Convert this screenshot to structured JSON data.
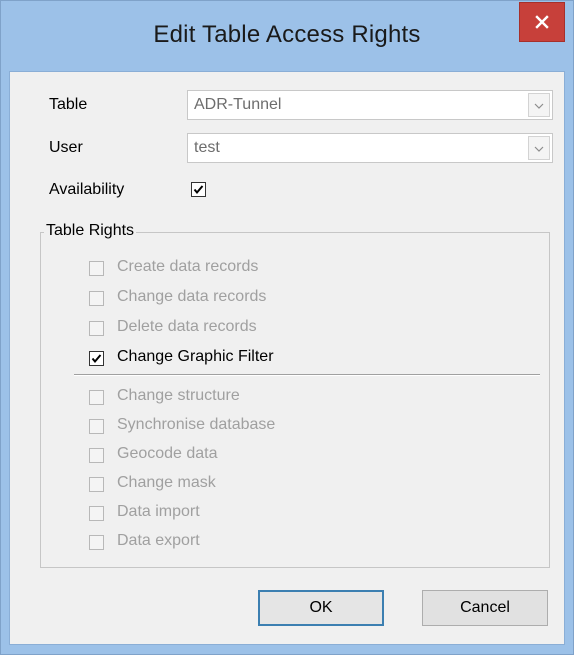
{
  "window": {
    "title": "Edit Table Access Rights",
    "close_icon": "close-icon"
  },
  "form": {
    "table_label": "Table",
    "table_value": "ADR-Tunnel",
    "user_label": "User",
    "user_value": "test",
    "availability_label": "Availability",
    "availability_checked": true
  },
  "table_rights": {
    "legend": "Table Rights",
    "group1": [
      {
        "label": "Create data records",
        "checked": false,
        "enabled": false
      },
      {
        "label": "Change data records",
        "checked": false,
        "enabled": false
      },
      {
        "label": "Delete data records",
        "checked": false,
        "enabled": false
      },
      {
        "label": "Change Graphic Filter",
        "checked": true,
        "enabled": true
      }
    ],
    "group2": [
      {
        "label": "Change structure",
        "checked": false,
        "enabled": false
      },
      {
        "label": "Synchronise database",
        "checked": false,
        "enabled": false
      },
      {
        "label": "Geocode data",
        "checked": false,
        "enabled": false
      },
      {
        "label": "Change mask",
        "checked": false,
        "enabled": false
      },
      {
        "label": "Data import",
        "checked": false,
        "enabled": false
      },
      {
        "label": "Data export",
        "checked": false,
        "enabled": false
      }
    ]
  },
  "buttons": {
    "ok_label": "OK",
    "cancel_label": "Cancel"
  }
}
